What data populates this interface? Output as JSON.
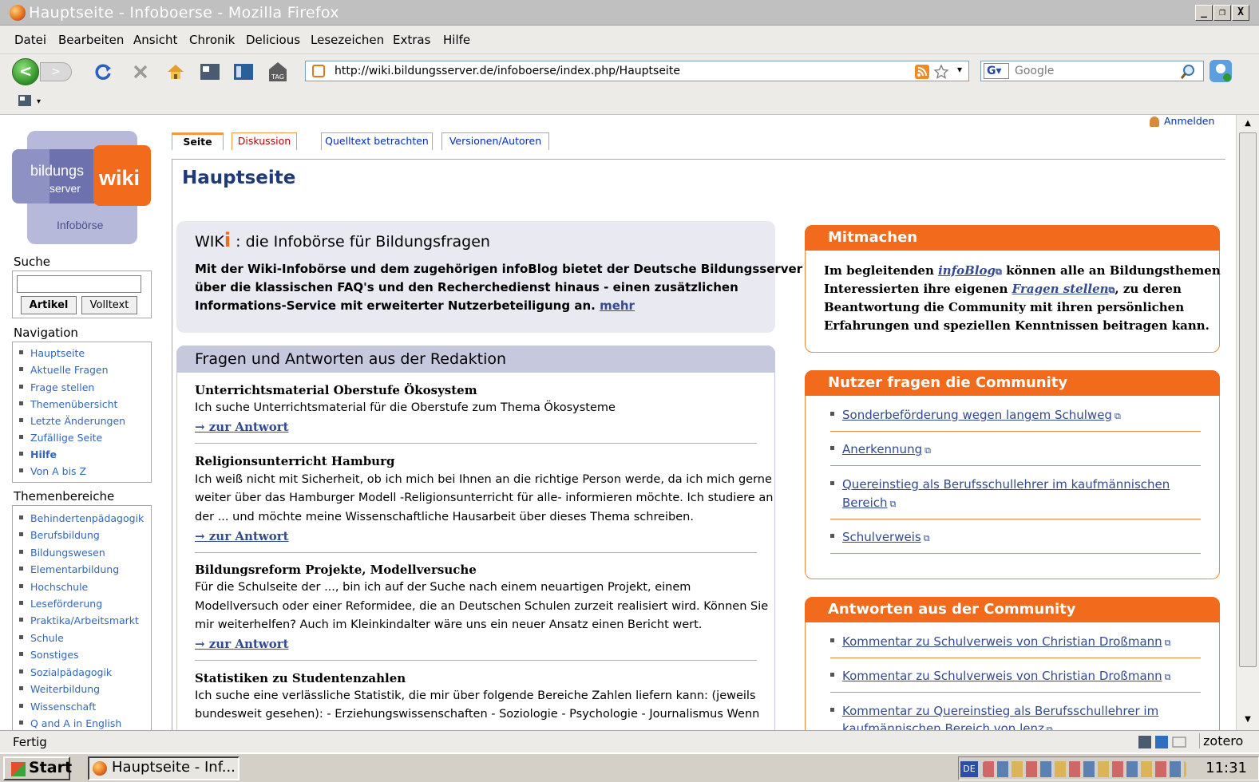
{
  "window": {
    "title": "Hauptseite - Infoboerse - Mozilla Firefox",
    "min_label": "_",
    "max_label": "❐",
    "close_label": "X"
  },
  "menu": [
    "Datei",
    "Bearbeiten",
    "Ansicht",
    "Chronik",
    "Delicious",
    "Lesezeichen",
    "Extras",
    "Hilfe"
  ],
  "toolbar": {
    "url": "http://wiki.bildungsserver.de/infoboerse/index.php/Hauptseite",
    "search_placeholder": "Google",
    "search_engine": "G",
    "back": "<",
    "forward": ">"
  },
  "status": {
    "text": "Fertig",
    "zotero": "zotero"
  },
  "taskbar": {
    "start": "Start",
    "window": "Hauptseite - Inf...",
    "time": "11:31",
    "lang": "DE"
  },
  "page": {
    "anmelden": "Anmelden",
    "logo": {
      "line1": "bildungs",
      "line2": "server",
      "wiki": "wiki",
      "sub": "Infobörse"
    },
    "search": {
      "heading": "Suche",
      "btn_article": "Artikel",
      "btn_full": "Volltext"
    },
    "navigation": {
      "heading": "Navigation",
      "items": [
        "Hauptseite",
        "Aktuelle Fragen",
        "Frage stellen",
        "Themenübersicht",
        "Letzte Änderungen",
        "Zufällige Seite",
        "Hilfe",
        "Von A bis Z"
      ]
    },
    "themen": {
      "heading": "Themenbereiche",
      "items": [
        "Behindertenpädagogik",
        "Berufsbildung",
        "Bildungswesen",
        "Elementarbildung",
        "Hochschule",
        "Leseförderung",
        "Praktika/Arbeitsmarkt",
        "Schule",
        "Sonstiges",
        "Sozialpädagogik",
        "Weiterbildung",
        "Wissenschaft",
        "Q and A in English"
      ]
    },
    "tabs": [
      "Seite",
      "Diskussion",
      "Quelltext betrachten",
      "Versionen/Autoren"
    ],
    "title": "Hauptseite",
    "intro": {
      "title_pre": "WIK",
      "title_i": "i",
      "title_post": " : die Infobörse für Bildungsfragen",
      "line1": "Mit der Wiki-Infobörse und dem zugehörigen infoBlog bietet der Deutsche Bildungsserver -",
      "line2": "über die klassischen FAQ's und den Recherchedienst hinaus - einen zusätzlichen",
      "line3": "Informations-Service mit erweiterter Nutzerbeteiligung an.",
      "more": "mehr"
    },
    "faq": {
      "heading": "Fragen und Antworten aus der Redaktion",
      "link": "→ zur Antwort",
      "items": [
        {
          "title": "Unterrichtsmaterial Oberstufe Ökosystem",
          "lines": [
            "Ich suche Unterrichtsmaterial für die Oberstufe zum Thema Ökosysteme"
          ]
        },
        {
          "title": "Religionsunterricht Hamburg",
          "lines": [
            "Ich weiß nicht mit Sicherheit, ob ich mich bei Ihnen an die richtige Person werde, da ich mich gerne",
            "weiter über das Hamburger Modell -Religionsunterricht für alle- informieren möchte. Ich studiere an",
            "der ... und möchte meine Wissenschaftliche Hausarbeit über dieses Thema schreiben."
          ]
        },
        {
          "title": "Bildungsreform Projekte, Modellversuche",
          "lines": [
            "Für die Schulseite der ..., bin ich auf der Suche nach einem neuartigen Projekt, einem",
            "Modellversuch oder einer Reformidee, die an Deutschen Schulen zurzeit realisiert wird. Können Sie",
            "mir weiterhelfen? Auch im Kleinkindalter wäre uns ein neuer Ansatz einen Bericht wert."
          ]
        },
        {
          "title": "Statistiken zu Studentenzahlen",
          "lines": [
            "Ich suche eine verlässliche Statistik, die mir über folgende Bereiche Zahlen liefern kann: (jeweils",
            "bundesweit gesehen): - Erziehungswissenschaften - Soziologie - Psychologie - Journalismus Wenn"
          ]
        }
      ]
    },
    "mitmachen": {
      "heading": "Mitmachen",
      "l1_pre": "Im begleitenden ",
      "l1_link": "infoBlog",
      "l1_post": " können alle an Bildungsthemen",
      "l2_pre": "Interessierten ihre eigenen ",
      "l2_link": "Fragen stellen",
      "l2_post": ", zu deren",
      "l3": "Beantwortung die Community mit ihren persönlichen",
      "l4": "Erfahrungen und speziellen Kenntnissen beitragen kann."
    },
    "nutzer": {
      "heading": "Nutzer fragen die Community",
      "items": [
        "Sonderbeförderung wegen langem Schulweg",
        "Anerkennung",
        "Quereinstieg als Berufsschullehrer im kaufmännischen",
        "Schulverweis"
      ],
      "item3_cont": "Bereich"
    },
    "antworten": {
      "heading": "Antworten aus der Community",
      "items": [
        "Kommentar zu Schulverweis von Christian Droßmann",
        "Kommentar zu Schulverweis von Christian Droßmann",
        "Kommentar zu Quereinstieg als Berufsschullehrer im"
      ],
      "item3_cont": "kaufmännischen Bereich von lenz"
    }
  },
  "icons": [
    "firefox-icon",
    "back-icon",
    "forward-icon",
    "reload-icon",
    "stop-icon",
    "home-icon",
    "rss-icon",
    "star-icon",
    "magnifier-icon",
    "external-link-icon",
    "user-icon"
  ],
  "colors": {
    "accent_orange": "#f26a1b",
    "faq_header": "#c6c8de",
    "link": "#334a8f",
    "title_blue": "#1e3a78"
  }
}
